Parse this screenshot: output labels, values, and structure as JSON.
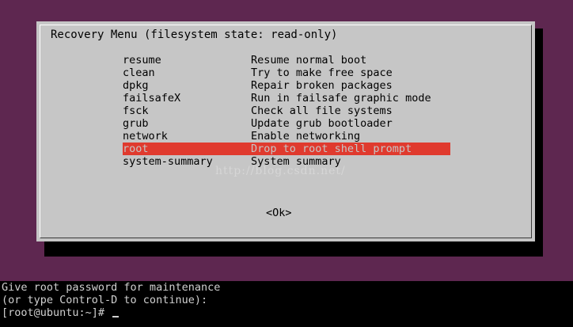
{
  "dialog": {
    "title": "Recovery Menu (filesystem state: read-only)",
    "ok_label": "<Ok>",
    "selected_index": 7
  },
  "menu": {
    "items": [
      {
        "key": "resume",
        "desc": "Resume normal boot"
      },
      {
        "key": "clean",
        "desc": "Try to make free space"
      },
      {
        "key": "dpkg",
        "desc": "Repair broken packages"
      },
      {
        "key": "failsafeX",
        "desc": "Run in failsafe graphic mode"
      },
      {
        "key": "fsck",
        "desc": "Check all file systems"
      },
      {
        "key": "grub",
        "desc": "Update grub bootloader"
      },
      {
        "key": "network",
        "desc": "Enable networking"
      },
      {
        "key": "root",
        "desc": "Drop to root shell prompt"
      },
      {
        "key": "system-summary",
        "desc": "System summary"
      }
    ]
  },
  "watermark": "http://blog.csdn.net/",
  "console": {
    "line1": "Give root password for maintenance",
    "line2": "(or type Control-D to continue):",
    "prompt": "[root@ubuntu:~]# "
  },
  "colors": {
    "background": "#5e2750",
    "dialog": "#c6c6c6",
    "selection": "#e03a2e",
    "console_bg": "#000000"
  }
}
